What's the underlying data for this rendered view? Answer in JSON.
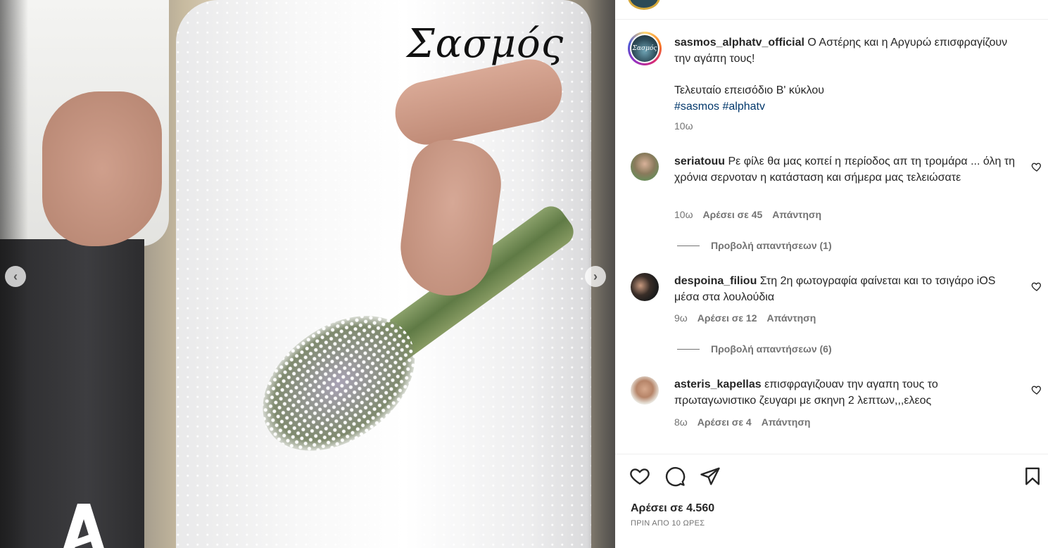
{
  "media": {
    "title_overlay": "Σασμός",
    "prev_label": "‹",
    "next_label": "›"
  },
  "post": {
    "username": "sasmos_alphatv_official",
    "avatar_text": "Σασμός",
    "caption_line1": "Ο Αστέρης και η Αργυρώ επισφραγίζουν την αγάπη τους!",
    "caption_line2": "Τελευταίο επεισόδιο Β' κύκλου",
    "hashtag1": "#sasmos",
    "hashtag2": "#alphatv",
    "time": "10ω"
  },
  "comments": [
    {
      "username": "seriatouu",
      "text": "Ρε φίλε θα μας κοπεί η περίοδος απ τη τρομάρα ... όλη τη χρόνια σερνοταν η κατάσταση και σήμερα μας τελειώσατε",
      "time": "10ω",
      "likes": "Αρέσει σε 45",
      "reply": "Απάντηση",
      "view_replies": "Προβολή απαντήσεων (1)"
    },
    {
      "username": "despoina_filiou",
      "text": "Στη 2η φωτογραφία φαίνεται και το τσιγάρο iOS μέσα στα λουλούδια",
      "time": "9ω",
      "likes": "Αρέσει σε 12",
      "reply": "Απάντηση",
      "view_replies": "Προβολή απαντήσεων (6)"
    },
    {
      "username": "asteris_kapellas",
      "text": "επισφραγιζουαν την αγαπη τους το πρωταγωνιστικο ζευγαρι με σκηνη 2 λεπτων,,,ελεος",
      "time": "8ω",
      "likes": "Αρέσει σε 4",
      "reply": "Απάντηση"
    }
  ],
  "footer": {
    "likes": "Αρέσει σε 4.560",
    "ago": "ΠΡΙΝ ΑΠΟ 10 ΩΡΕΣ"
  },
  "icons": {
    "like": "heart-icon",
    "comment": "comment-bubble-icon",
    "share": "paper-plane-icon",
    "save": "bookmark-icon"
  }
}
